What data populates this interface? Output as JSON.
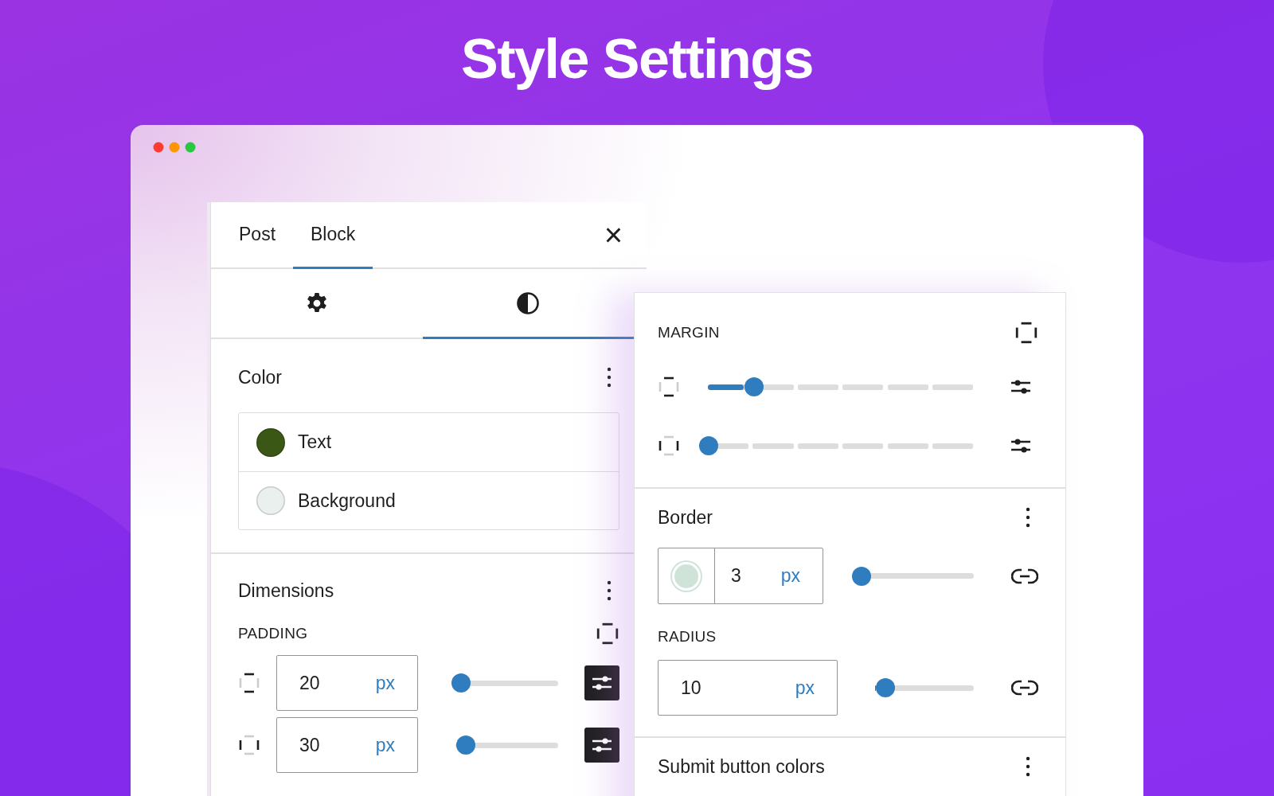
{
  "headline": "Style Settings",
  "sidebar": {
    "tabs": [
      {
        "label": "Post",
        "selected": false
      },
      {
        "label": "Block",
        "selected": true
      }
    ],
    "close": "×",
    "subtabs": [
      {
        "kind": "settings",
        "selected": false
      },
      {
        "kind": "styles",
        "selected": true
      }
    ],
    "color": {
      "title": "Color",
      "items": [
        {
          "label": "Text",
          "color": "#3b5716"
        },
        {
          "label": "Background",
          "color": "#e9f0ed"
        }
      ]
    },
    "dimensions": {
      "title": "Dimensions",
      "padding": {
        "label": "PADDING",
        "rows": [
          {
            "kind": "vertical",
            "value": "20",
            "unit": "px",
            "level": 0.05,
            "custom": true
          },
          {
            "kind": "horizontal",
            "value": "30",
            "unit": "px",
            "level": 0.09,
            "custom": true
          }
        ]
      }
    }
  },
  "styles_panel": {
    "margin": {
      "label": "MARGIN",
      "rows": [
        {
          "kind": "vertical",
          "level": 0.17,
          "custom": false
        },
        {
          "kind": "horizontal",
          "level": 0,
          "custom": false
        }
      ]
    },
    "border": {
      "title": "Border",
      "color": "#cfe3d9",
      "value": "3",
      "unit": "px",
      "level": 0,
      "radius": {
        "label": "RADIUS",
        "value": "10",
        "unit": "px",
        "level": 0.1
      }
    },
    "submit": {
      "title": "Submit button colors"
    }
  }
}
